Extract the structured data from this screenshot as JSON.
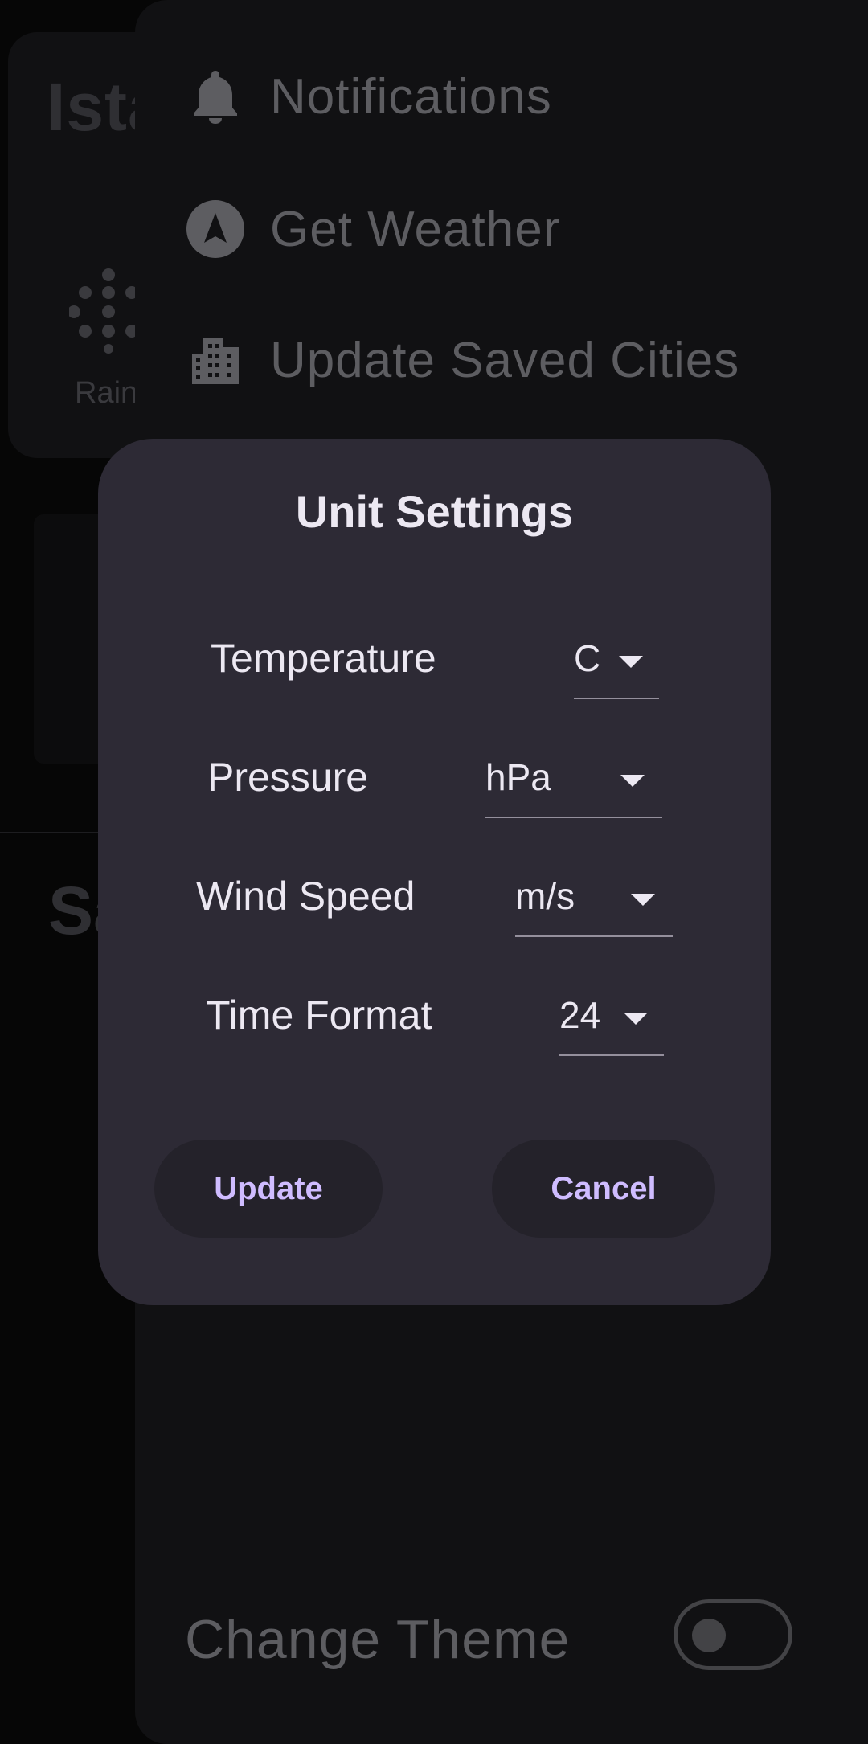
{
  "background": {
    "city_title": "Ista",
    "rain_label": "Rain",
    "saved_title": "Sa"
  },
  "drawer": {
    "items": [
      {
        "label": "Notifications",
        "icon": "bell-icon"
      },
      {
        "label": "Get Weather",
        "icon": "navigation-arrow-icon"
      },
      {
        "label": "Update Saved Cities",
        "icon": "city-buildings-icon"
      }
    ],
    "theme": {
      "label": "Change Theme",
      "enabled": false
    }
  },
  "dialog": {
    "title": "Unit Settings",
    "settings": [
      {
        "label": "Temperature",
        "value": "C"
      },
      {
        "label": "Pressure",
        "value": "hPa"
      },
      {
        "label": "Wind Speed",
        "value": "m/s"
      },
      {
        "label": "Time Format",
        "value": "24"
      }
    ],
    "update_label": "Update",
    "cancel_label": "Cancel"
  },
  "colors": {
    "dialog_bg": "#2d2a35",
    "accent": "#cfbcff",
    "drawer_bg": "#111113",
    "scrim_text": "#5d5d61"
  }
}
